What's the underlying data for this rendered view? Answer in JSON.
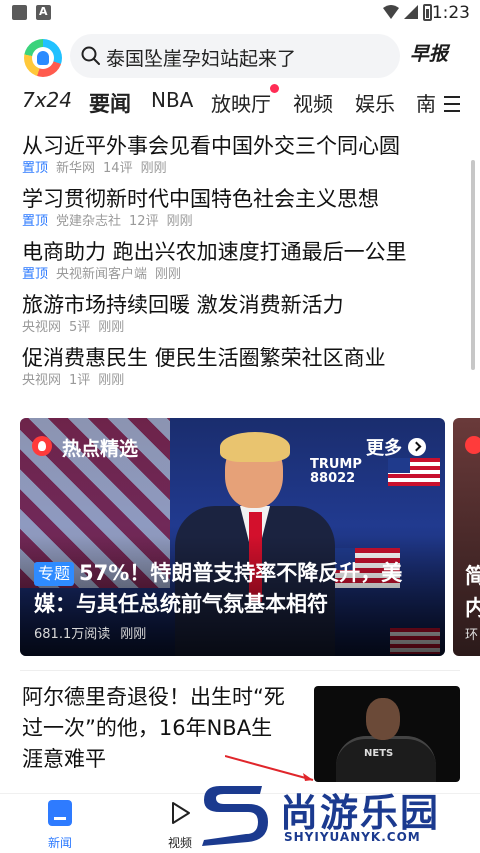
{
  "status_bar": {
    "time": "1:23"
  },
  "search": {
    "query": "泰国坠崖孕妇站起来了",
    "morning_label": "早报"
  },
  "tabs": [
    {
      "label": "7x24"
    },
    {
      "label": "要闻"
    },
    {
      "label": "NBA"
    },
    {
      "label": "放映厅"
    },
    {
      "label": "视频"
    },
    {
      "label": "娱乐"
    },
    {
      "label": "南"
    }
  ],
  "headlines": [
    {
      "title": "从习近平外事会见看中国外交三个同心圆",
      "top": "置顶",
      "source": "新华网",
      "comments": "14评",
      "time": "刚刚"
    },
    {
      "title": "学习贯彻新时代中国特色社会主义思想",
      "top": "置顶",
      "source": "党建杂志社",
      "comments": "12评",
      "time": "刚刚"
    },
    {
      "title": "电商助力 跑出兴农加速度打通最后一公里",
      "top": "置顶",
      "source": "央视新闻客户端",
      "comments": "",
      "time": "刚刚"
    },
    {
      "title": "旅游市场持续回暖 激发消费新活力",
      "top": "",
      "source": "央视网",
      "comments": "5评",
      "time": "刚刚"
    },
    {
      "title": "促消费惠民生 便民生活圈繁荣社区商业",
      "top": "",
      "source": "央视网",
      "comments": "1评",
      "time": "刚刚"
    }
  ],
  "hot_card": {
    "section_title": "热点精选",
    "more_label": "更多",
    "tag": "专题",
    "headline": "57%！特朗普支持率不降反升，美媒：与其任总统前气氛基本相符",
    "reads": "681.1万阅读",
    "time": "刚刚",
    "sign_text": "TRUMP\n88022"
  },
  "next_card": {
    "line1": "简",
    "line2": "内",
    "meta": "环"
  },
  "article": {
    "title": "阿尔德里奇退役！出生时“死过一次”的他，16年NBA生涯意难平"
  },
  "bottom_nav": {
    "news_label": "新闻",
    "video_label": "视频"
  },
  "watermark": {
    "title": "尚游乐园",
    "url": "SHYIYUANYK.COM"
  },
  "colors": {
    "accent": "#2e7bff",
    "tab_dot": "#ff2d55",
    "watermark": "#1b3a8f"
  }
}
